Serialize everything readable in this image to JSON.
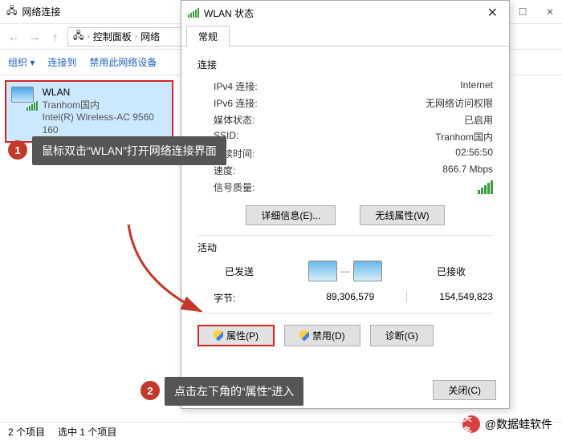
{
  "explorer": {
    "title": "网络连接",
    "path": {
      "seg1": "控制面板",
      "seg2": "网络"
    },
    "toolbar": {
      "org": "组织 ▾",
      "connect": "连接到",
      "disable": "禁用此网络设备"
    },
    "item": {
      "name": "WLAN",
      "ssid": "Tranhom国内",
      "adapter": "Intel(R) Wireless-AC 9560 160"
    },
    "status": {
      "count": "2 个项目",
      "selected": "选中 1 个项目"
    }
  },
  "dialog": {
    "title": "WLAN 状态",
    "tab": "常规",
    "conn_section": "连接",
    "fields": {
      "ipv4_label": "IPv4 连接:",
      "ipv4_val": "Internet",
      "ipv6_label": "IPv6 连接:",
      "ipv6_val": "无网络访问权限",
      "media_label": "媒体状态:",
      "media_val": "已启用",
      "ssid_label": "SSID:",
      "ssid_val": "Tranhom国内",
      "duration_label": "持续时间:",
      "duration_val": "02:56:50",
      "speed_label": "速度:",
      "speed_val": "866.7 Mbps",
      "quality_label": "信号质量:"
    },
    "buttons": {
      "details": "详细信息(E)...",
      "wifi_props": "无线属性(W)"
    },
    "activity_section": "活动",
    "activity": {
      "sent": "已发送",
      "recv": "已接收",
      "bytes_label": "字节:",
      "sent_val": "89,306,579",
      "recv_val": "154,549,823"
    },
    "actions": {
      "props": "属性(P)",
      "disable": "禁用(D)",
      "diag": "诊断(G)"
    },
    "close": "关闭(C)"
  },
  "annotations": {
    "badge1": "1",
    "text1": "鼠标双击“WLAN”打开网络连接界面",
    "badge2": "2",
    "text2": "点击左下角的“属性”进入"
  },
  "watermark": {
    "prefix": "头条",
    "text": "@数据蛙软件"
  }
}
